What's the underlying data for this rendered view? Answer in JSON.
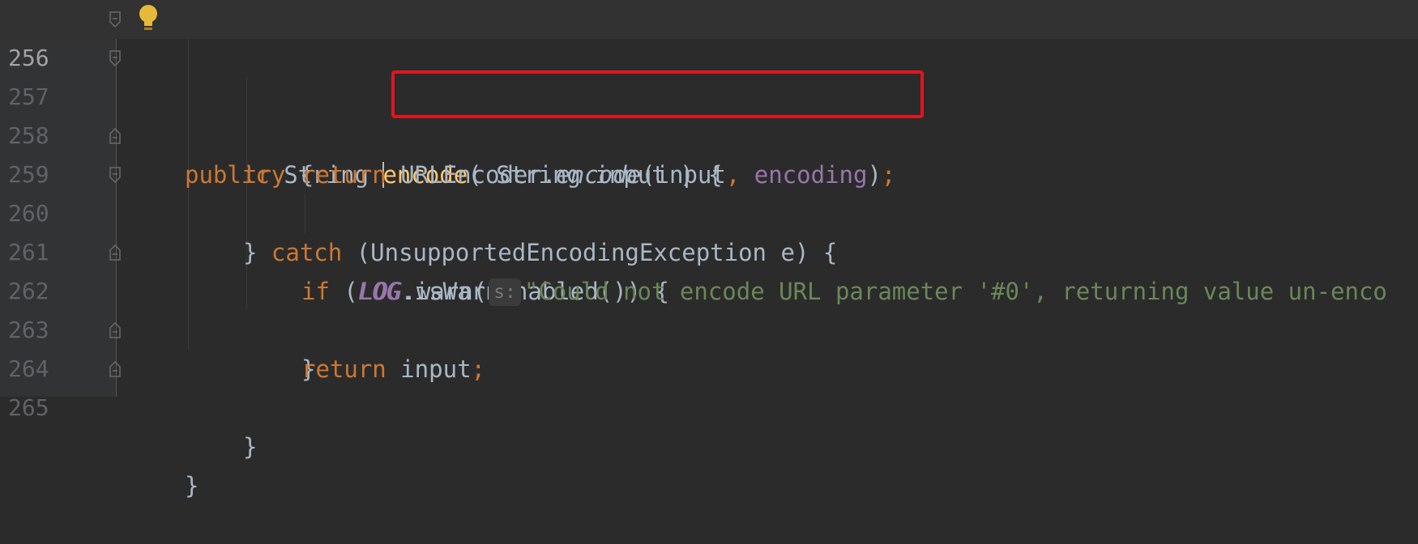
{
  "gutter": {
    "line_numbers": [
      "256",
      "257",
      "258",
      "259",
      "260",
      "261",
      "262",
      "263",
      "264",
      "265"
    ]
  },
  "code": {
    "l256": {
      "kw1": "public",
      "type1": " String ",
      "method": "encode",
      "open": "( String input ) {"
    },
    "l257": {
      "kw": "try",
      "rest": " {"
    },
    "l258": {
      "kw": "return",
      "space": " ",
      "cls": "URLEncoder.",
      "method": "encode",
      "arg1": "(input",
      "comma": ", ",
      "field": "encoding",
      "close": ")",
      "semi": ";"
    },
    "l259": {
      "brace": "} ",
      "kw": "catch",
      "rest": " (UnsupportedEncodingException e) {"
    },
    "l260": {
      "kw": "if",
      "open": " (",
      "field": "LOG",
      "rest": ".isWarnEnabled()) {"
    },
    "l261": {
      "field": "LOG",
      "call": ".warn(",
      "hint": "s:",
      "string": "\"Could not encode URL parameter '#0', returning value un-enco"
    },
    "l262": {
      "brace": "}"
    },
    "l263": {
      "kw": "return",
      "rest": " input",
      "semi": ";"
    },
    "l264": {
      "brace": "}"
    },
    "l265": {
      "brace": "}"
    }
  },
  "icons": {
    "intention_bulb": "lightbulb-icon",
    "fold": "fold-marker-icon"
  },
  "colors": {
    "background": "#2b2b2b",
    "keyword": "#cc7832",
    "field": "#9876aa",
    "string": "#6a8759",
    "method_declaration": "#ffc66d",
    "highlight_box": "#e0161f"
  }
}
